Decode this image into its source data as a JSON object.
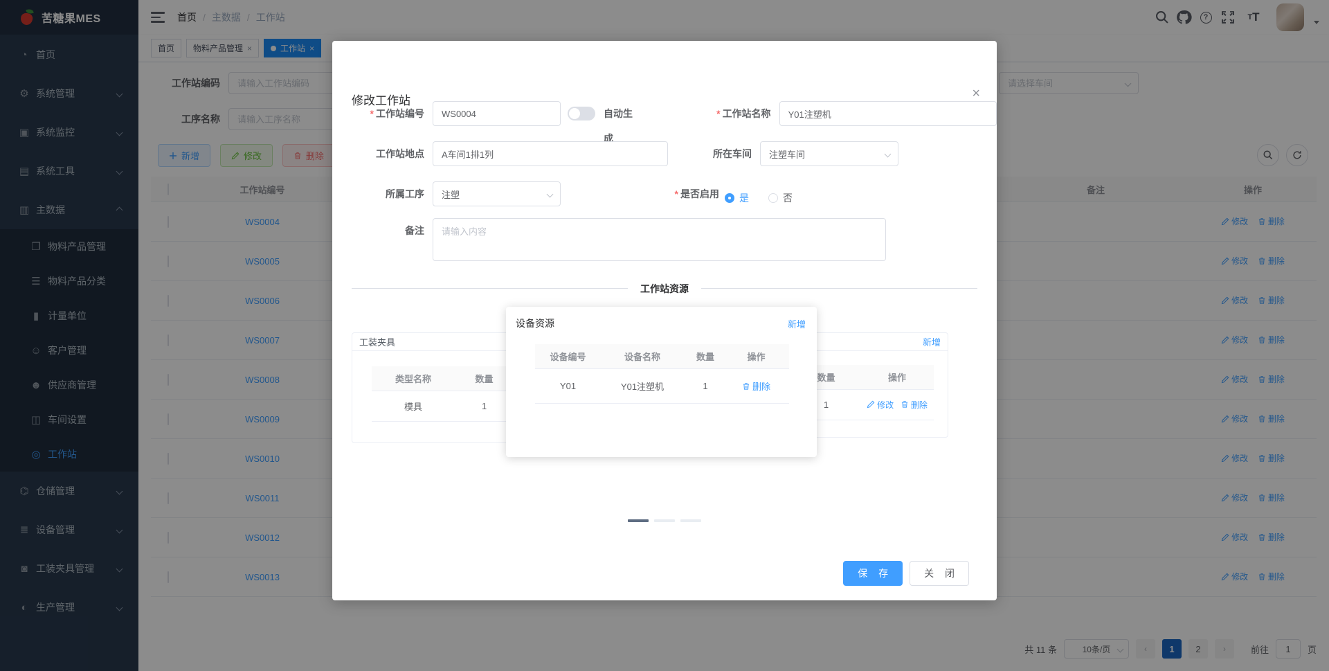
{
  "app": {
    "logo_text": "苦糖果MES"
  },
  "breadcrumb": {
    "items": [
      "首页",
      "主数据",
      "工作站"
    ],
    "separator": "/"
  },
  "sidebar": {
    "items_top": [
      {
        "label": "首页"
      },
      {
        "label": "系统管理"
      },
      {
        "label": "系统监控"
      },
      {
        "label": "系统工具"
      },
      {
        "label": "主数据"
      }
    ],
    "submenu": [
      {
        "label": "物料产品管理"
      },
      {
        "label": "物料产品分类"
      },
      {
        "label": "计量单位"
      },
      {
        "label": "客户管理"
      },
      {
        "label": "供应商管理"
      },
      {
        "label": "车间设置"
      },
      {
        "label": "工作站"
      }
    ],
    "items_bottom": [
      {
        "label": "仓储管理"
      },
      {
        "label": "设备管理"
      },
      {
        "label": "工装夹具管理"
      },
      {
        "label": "生产管理"
      }
    ]
  },
  "tabs": [
    {
      "label": "首页"
    },
    {
      "label": "物料产品管理",
      "close": "×"
    },
    {
      "label": "工作站",
      "close": "×"
    }
  ],
  "filters": {
    "code_label": "工作站编码",
    "code_placeholder": "请输入工作站编码",
    "process_label": "工序名称",
    "process_placeholder": "请输入工序名称",
    "workshop_placeholder": "请选择车间"
  },
  "toolbar": {
    "add": "新增",
    "edit": "修改",
    "delete": "删除"
  },
  "table": {
    "headers": {
      "code": "工作站编号",
      "remark": "备注",
      "actions": "操作"
    },
    "row_actions": {
      "edit": "修改",
      "delete": "删除"
    },
    "rows": [
      {
        "code": "WS0004"
      },
      {
        "code": "WS0005"
      },
      {
        "code": "WS0006"
      },
      {
        "code": "WS0007"
      },
      {
        "code": "WS0008"
      },
      {
        "code": "WS0009"
      },
      {
        "code": "WS0010"
      },
      {
        "code": "WS0011"
      },
      {
        "code": "WS0012"
      },
      {
        "code": "WS0013"
      }
    ]
  },
  "pagination": {
    "total": "共 11 条",
    "page_size": "10条/页",
    "prev": "‹",
    "next": "›",
    "pages": [
      "1",
      "2"
    ],
    "active_page": "1",
    "goto_label": "前往",
    "goto_value": "1",
    "page_suffix": "页"
  },
  "modal": {
    "title": "修改工作站",
    "close": "×",
    "fields": {
      "code": {
        "label": "工作站编号",
        "value": "WS0004"
      },
      "auto_gen_label": "自动生成",
      "name": {
        "label": "工作站名称",
        "value": "Y01注塑机"
      },
      "location": {
        "label": "工作站地点",
        "value": "A车间1排1列"
      },
      "workshop": {
        "label": "所在车间",
        "value": "注塑车间"
      },
      "process": {
        "label": "所属工序",
        "value": "注塑"
      },
      "enabled": {
        "label": "是否启用",
        "yes": "是",
        "no": "否"
      },
      "remark": {
        "label": "备注",
        "placeholder": "请输入内容"
      }
    },
    "section_title": "工作站资源",
    "fixture_card": {
      "title": "工装夹具",
      "add": "新增",
      "headers": [
        "类型名称",
        "数量"
      ],
      "row": {
        "type": "模具",
        "qty": "1",
        "edit": "修改"
      }
    },
    "equipment_card": {
      "title": "设备资源",
      "add": "新增",
      "headers": [
        "设备编号",
        "设备名称",
        "数量",
        "操作"
      ],
      "row": {
        "code": "Y01",
        "name": "Y01注塑机",
        "qty": "1",
        "delete": "删除"
      }
    },
    "right_card": {
      "add": "新增",
      "headers": [
        "数量",
        "操作"
      ],
      "row": {
        "qty": "1",
        "edit": "修改",
        "delete": "删除"
      }
    },
    "footer": {
      "save": "保 存",
      "close": "关 闭"
    }
  }
}
